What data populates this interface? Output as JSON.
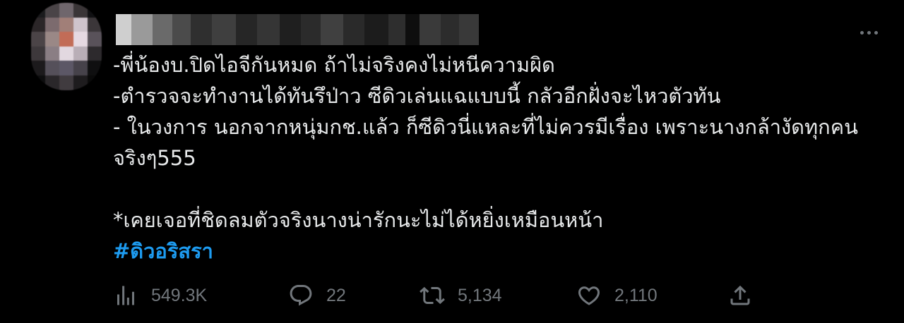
{
  "tweet": {
    "lines": [
      "-พี่น้องบ.ปิดไอจีกันหมด ถ้าไม่จริงคงไม่หนีความผิด",
      "-ตำรวจจะทำงานได้ทันรึป่าว ซีดิวเล่นแฉแบบนี้ กลัวอีกฝั่งจะไหวตัวทัน",
      "- ในวงการ นอกจากหนุ่มกช.แล้ว ก็ซีดิวนี่แหละที่ไม่ควรมีเรื่อง เพราะนางกล้างัดทุกคน",
      "จริงๆ555",
      "*เคยเจอที่ชิดลมตัวจริงนางน่ารักนะไม่ได้หยิ่งเหมือนหน้า"
    ],
    "hashtag": "#ดิวอริสรา"
  },
  "actions": {
    "views": "549.3K",
    "replies": "22",
    "retweets": "5,134",
    "likes": "2,110"
  },
  "icons": {
    "views": "bar-chart-icon",
    "reply": "speech-bubble-icon",
    "retweet": "retweet-arrows-icon",
    "like": "heart-icon",
    "share": "share-upload-icon",
    "more": "more-dots-icon"
  },
  "colors": {
    "background": "#000000",
    "text": "#e7e9ea",
    "muted": "#71767b",
    "link": "#1d9bf0"
  }
}
